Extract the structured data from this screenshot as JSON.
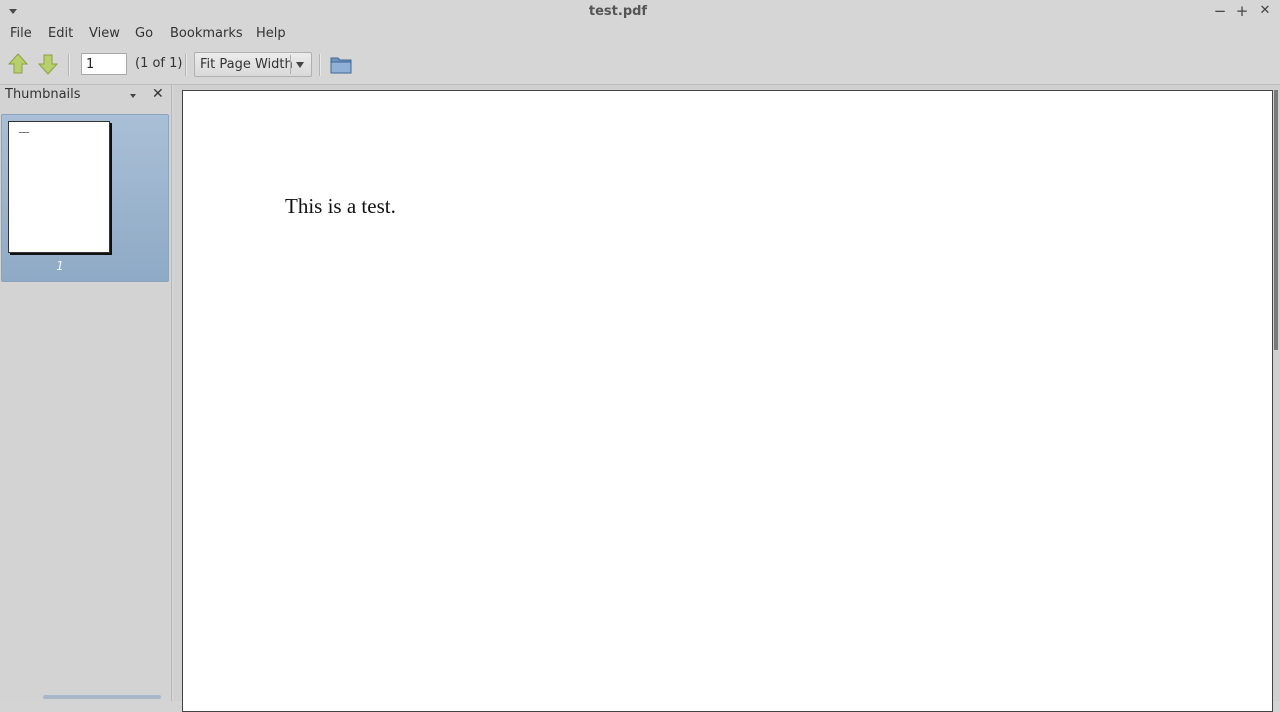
{
  "window": {
    "title": "test.pdf",
    "controls": {
      "minimize": "−",
      "maximize": "+",
      "close": "✕"
    }
  },
  "menu": [
    "File",
    "Edit",
    "View",
    "Go",
    "Bookmarks",
    "Help"
  ],
  "toolbar": {
    "prev_icon": "arrow-up-icon",
    "next_icon": "arrow-down-icon",
    "page_input_value": "1",
    "page_count": "(1 of 1)",
    "zoom_selected": "Fit Page Width",
    "open_icon": "folder-icon"
  },
  "sidebar": {
    "title": "Thumbnails",
    "close": "✕",
    "thumbnails": [
      {
        "number": "1",
        "selected": true
      }
    ]
  },
  "document": {
    "text": "This is a test."
  },
  "colors": {
    "chrome": "#d6d6d6",
    "selection": "#9cb4cf",
    "nav_arrow": "#b9cf6e"
  }
}
